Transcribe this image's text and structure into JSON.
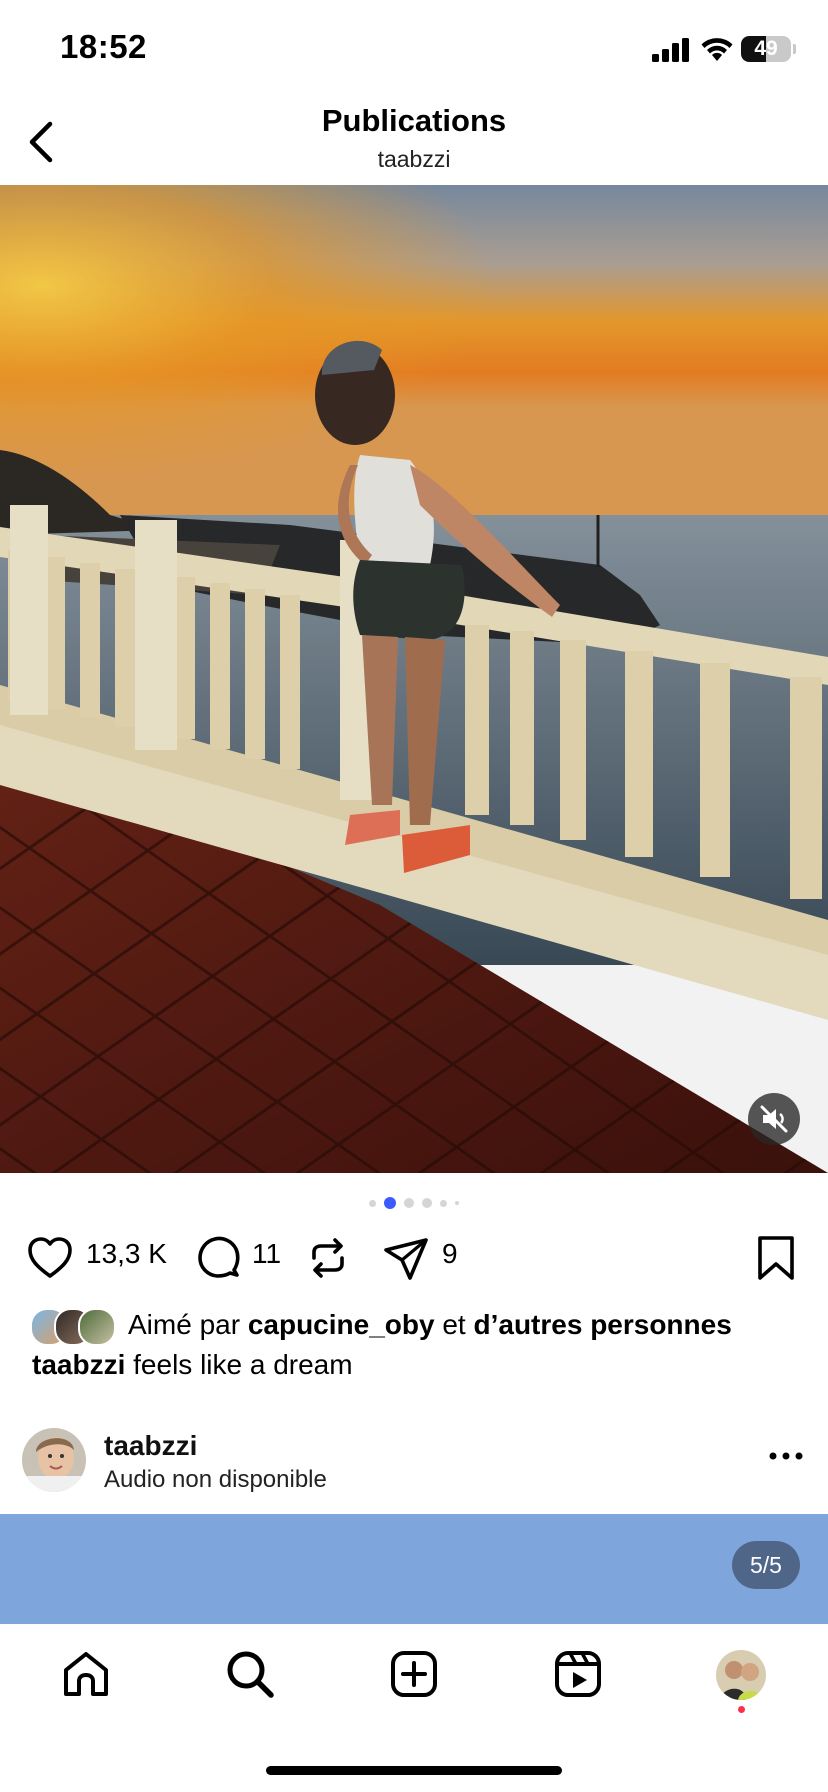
{
  "status_bar": {
    "time": "18:52",
    "battery": "49",
    "battery_level": 0.49
  },
  "header": {
    "title": "Publications",
    "subtitle": "taabzzi",
    "back_icon": "chevron-left-icon"
  },
  "post": {
    "image_description_icon": "photo",
    "carousel": {
      "count": 6,
      "active_index": 1
    },
    "actions": {
      "likes": "13,3 K",
      "comments": "11",
      "shares": "9"
    },
    "liked_by": {
      "prefix": "Aimé par ",
      "user": "capucine_oby",
      "middle": " et ",
      "others": "d’autres personnes"
    },
    "caption": {
      "user": "taabzzi",
      "text": " feels like a dream"
    }
  },
  "next_post": {
    "username": "taabzzi",
    "audio": "Audio non disponible",
    "counter": "5/5"
  },
  "colors": {
    "accent": "#3b5bff",
    "notification": "#ff2e4c"
  }
}
